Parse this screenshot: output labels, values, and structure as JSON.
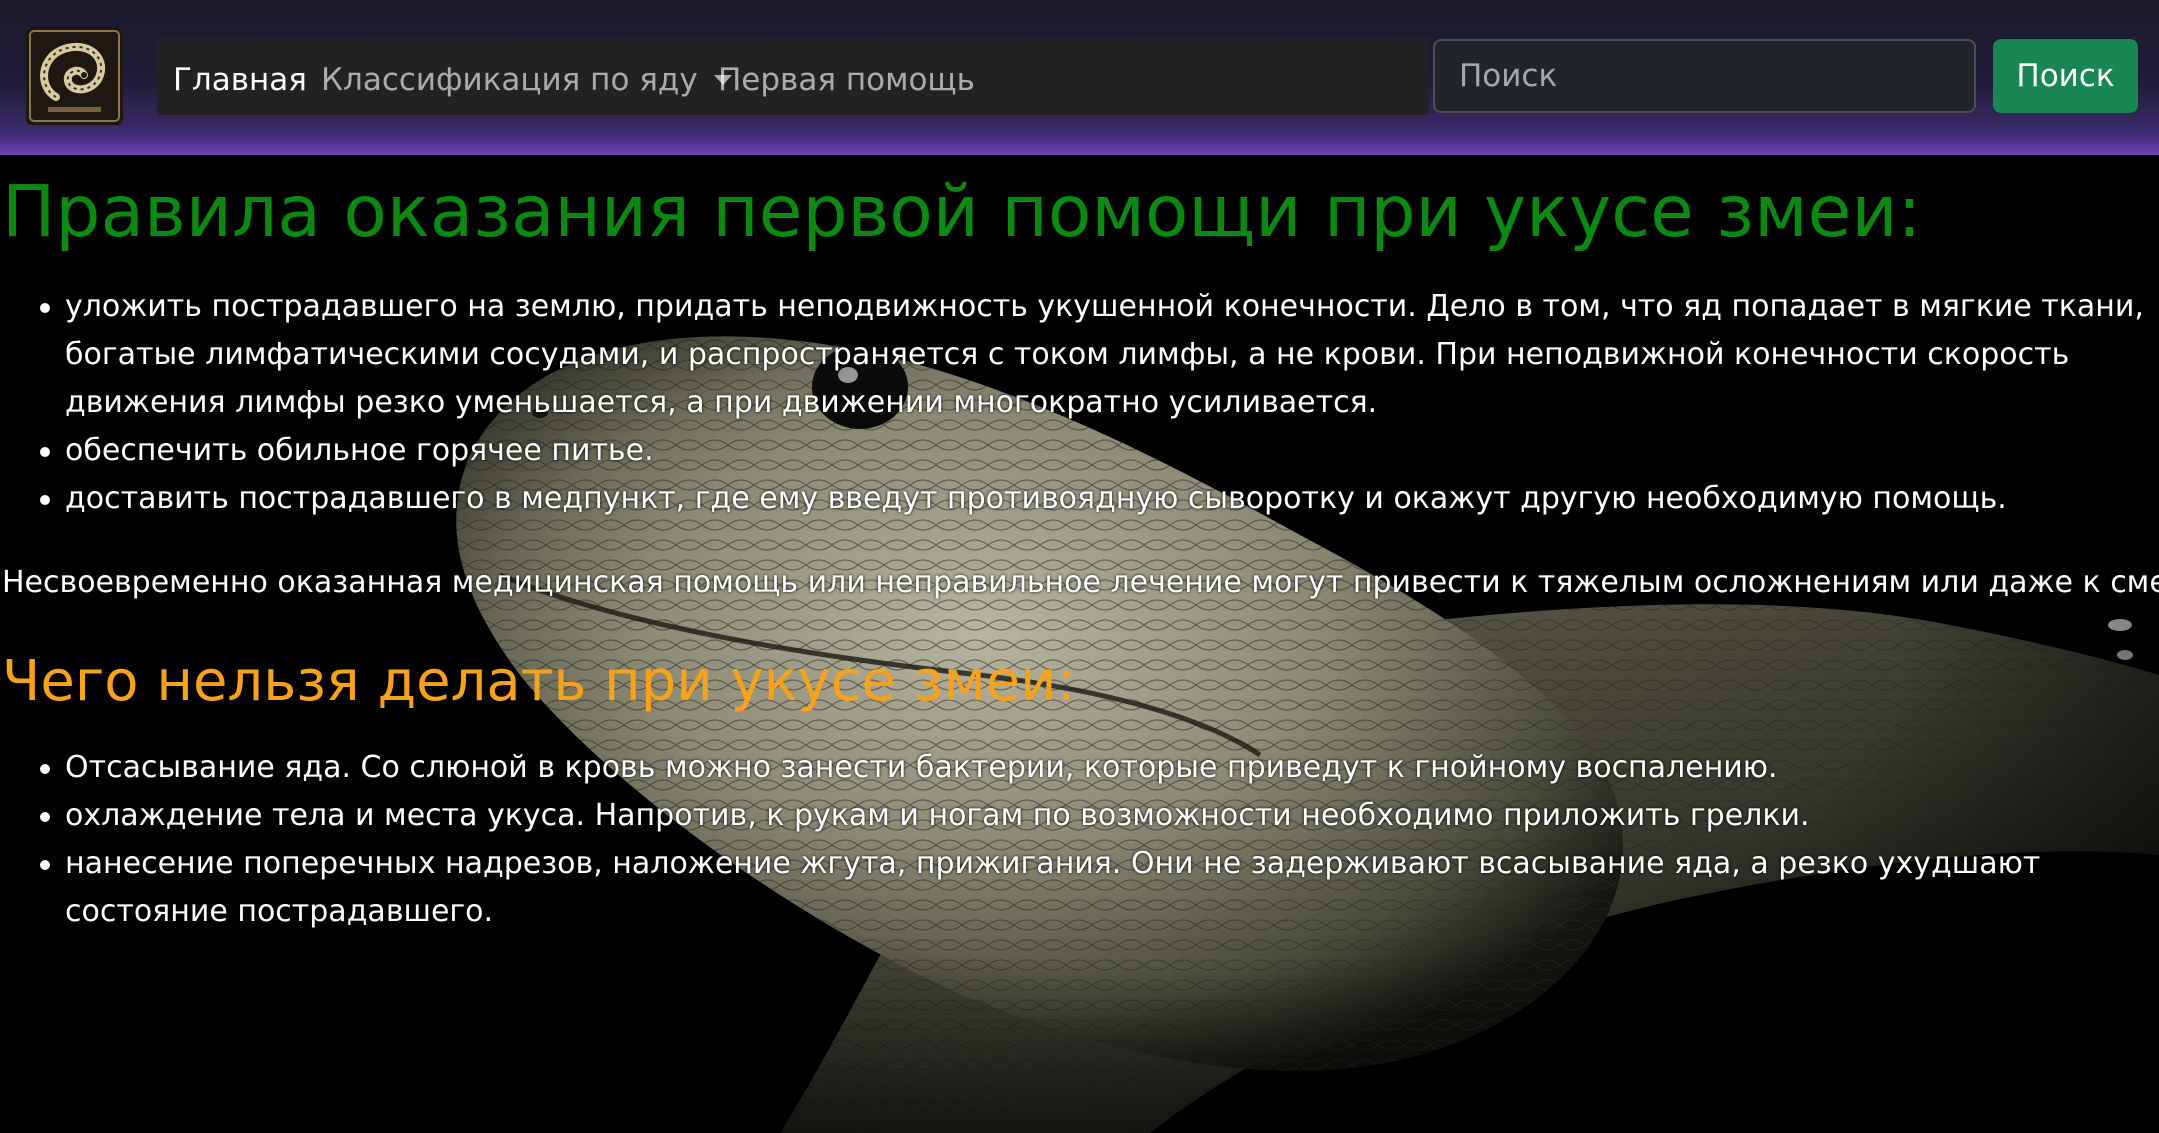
{
  "colors": {
    "heading_primary": "#0b8a12",
    "heading_secondary": "#f7a219",
    "search_button": "#198754",
    "navbar_gradient_end": "#6e3fb5"
  },
  "navbar": {
    "logo_icon": "snake-emblem-icon",
    "links": [
      {
        "label": "Главная",
        "active": true
      },
      {
        "label": "Классификация по яду",
        "dropdown": true
      },
      {
        "label": "Первая помощь"
      }
    ],
    "search": {
      "placeholder": "Поиск",
      "value": "",
      "button_label": "Поиск"
    }
  },
  "main": {
    "title": "Правила оказания первой помощи при укусе змеи:",
    "do_list": [
      "уложить пострадавшего на землю, придать неподвижность укушенной конечности. Дело в том, что яд попадает в мягкие ткани, богатые лимфатическими сосудами, и распространяется с током лимфы, а не крови. При неподвижной конечности скорость движения лимфы резко уменьшается, а при движении многократно усиливается.",
      "обеспечить обильное горячее питье.",
      "доставить пострадавшего в медпункт, где ему введут противоядную сыворотку и окажут другую необходимую помощь."
    ],
    "note": "Несвоевременно оказанная медицинская помощь или неправильное лечение могут привести к тяжелым осложнениям или даже к смерти.",
    "dont_title": "Чего нельзя делать при укусе змеи:",
    "dont_list": [
      "Отсасывание яда. Со слюной в кровь можно занести бактерии, которые приведут к гнойному воспалению.",
      "охлаждение тела и места укуса. Напротив, к рукам и ногам по возможности необходимо приложить грелки.",
      "нанесение поперечных надрезов, наложение жгута, прижигания. Они не задерживают всасывание яда, а резко ухудшают состояние пострадавшего."
    ]
  },
  "background_image": "black-mamba-snake-image"
}
